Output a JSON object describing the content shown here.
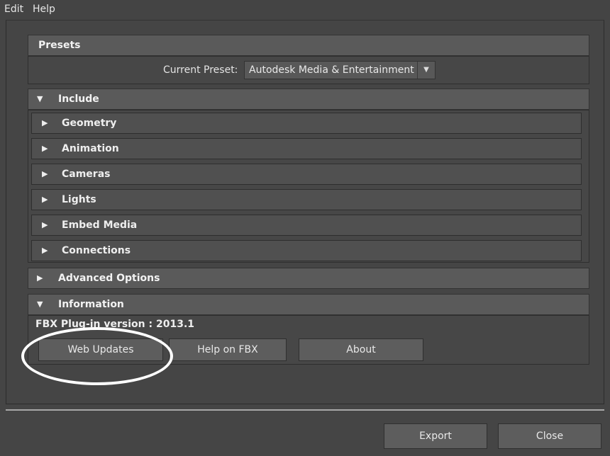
{
  "menu": {
    "edit": "Edit",
    "help": "Help"
  },
  "presets": {
    "title": "Presets",
    "current_preset_label": "Current Preset:",
    "current_preset_value": "Autodesk Media & Entertainment"
  },
  "include": {
    "title": "Include",
    "expanded": true,
    "items": [
      {
        "label": "Geometry"
      },
      {
        "label": "Animation"
      },
      {
        "label": "Cameras"
      },
      {
        "label": "Lights"
      },
      {
        "label": "Embed Media"
      },
      {
        "label": "Connections"
      }
    ]
  },
  "advanced": {
    "title": "Advanced Options",
    "expanded": false
  },
  "information": {
    "title": "Information",
    "expanded": true,
    "version_text": "FBX Plug-in version : 2013.1",
    "buttons": {
      "web_updates": "Web Updates",
      "help_on_fbx": "Help on FBX",
      "about": "About"
    }
  },
  "footer": {
    "export": "Export",
    "close": "Close"
  },
  "icons": {
    "expanded": "triangle-down-icon",
    "collapsed": "triangle-right-icon",
    "dropdown": "chevron-down-icon"
  },
  "colors": {
    "background": "#454545",
    "header": "#5a5a5a",
    "button": "#5d5d5d",
    "annotation": "#ffffff"
  }
}
